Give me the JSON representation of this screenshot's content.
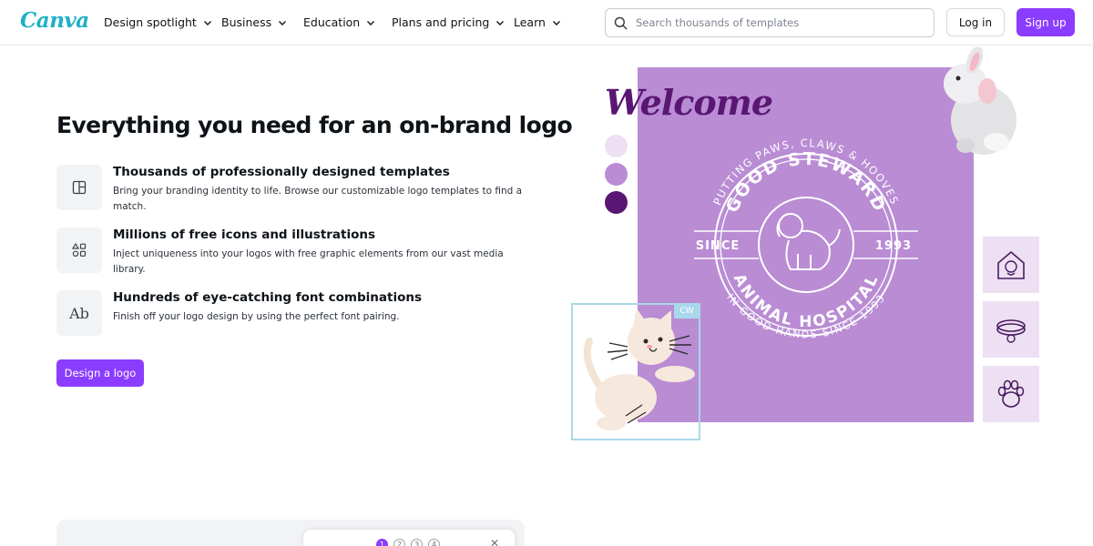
{
  "header": {
    "brand": "Canva",
    "nav": [
      {
        "label": "Design spotlight"
      },
      {
        "label": "Business"
      },
      {
        "label": "Education"
      },
      {
        "label": "Plans and pricing"
      },
      {
        "label": "Learn"
      }
    ],
    "search": {
      "placeholder": "Search thousands of templates",
      "icon": "search-icon"
    },
    "login_label": "Log in",
    "signup_label": "Sign up"
  },
  "hero": {
    "title": "Everything you need for an on-brand logo",
    "features": [
      {
        "icon": "template-layout-icon",
        "title": "Thousands of professionally designed templates",
        "description": "Bring your branding identity to life. Browse our customizable logo templates to find a match."
      },
      {
        "icon": "shapes-icon",
        "title": "Millions of free icons and illustrations",
        "description": "Inject uniqueness into your logos with free graphic elements from our vast media library."
      },
      {
        "icon": "font-ab-icon",
        "icon_text": "Ab",
        "title": "Hundreds of eye-catching font combinations",
        "description": "Finish off your logo design by using the perfect font pairing."
      }
    ],
    "cta_label": "Design a logo"
  },
  "artwork": {
    "welcome": "Welcome",
    "swatches": [
      "#ece0f2",
      "#b98cd4",
      "#5a1673"
    ],
    "poster_color": "#b98cd4",
    "badge": {
      "top_arc": "PUTTING PAWS, CLAWS & HOOVES",
      "name_arc": "GOOD STEWARD",
      "since": "SINCE",
      "year": "1993",
      "sub_arc": "ANIMAL HOSPITAL",
      "bottom_arc": "IN GOOD HANDS SINCE 1993"
    },
    "cw_tag": "CW",
    "side_icons": [
      "house-pet-icon",
      "pet-collar-icon",
      "paw-icon"
    ]
  },
  "bottom": {
    "steps": [
      "1",
      "2",
      "3",
      "4"
    ],
    "close_icon": "close-icon"
  },
  "colors": {
    "brand_purple": "#8b3dff",
    "brand_teal": "#1fb0c7"
  }
}
